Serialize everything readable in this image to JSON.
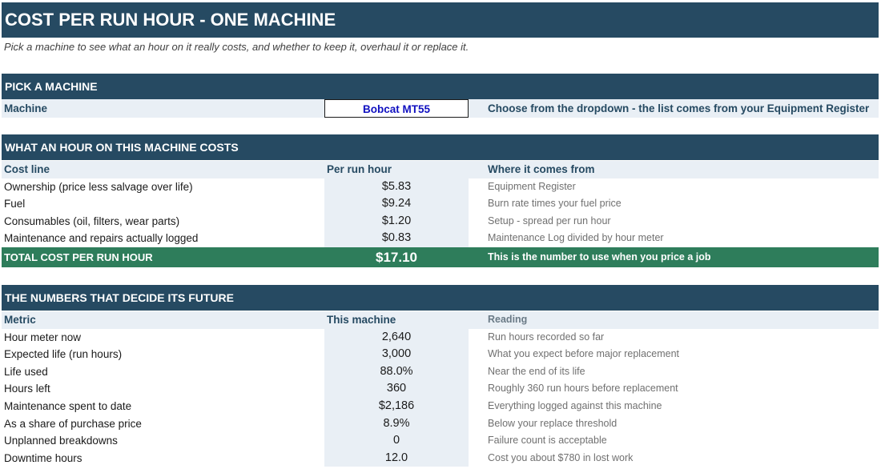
{
  "title": "COST PER RUN HOUR - ONE MACHINE",
  "subtitle": "Pick a machine to see what an hour on it really costs, and whether to keep it, overhaul it or replace it.",
  "pick": {
    "header": "PICK A MACHINE",
    "label": "Machine",
    "value": "Bobcat MT55",
    "hint": "Choose from the dropdown - the list comes from your Equipment Register"
  },
  "costs": {
    "header": "WHAT AN HOUR ON THIS MACHINE COSTS",
    "col1": "Cost line",
    "col2": "Per run hour",
    "col3": "Where it comes from",
    "rows": [
      {
        "label": "Ownership (price less salvage over life)",
        "value": "$5.83",
        "source": "Equipment Register"
      },
      {
        "label": "Fuel",
        "value": "$9.24",
        "source": "Burn rate times your fuel price"
      },
      {
        "label": "Consumables (oil, filters, wear parts)",
        "value": "$1.20",
        "source": "Setup - spread per run hour"
      },
      {
        "label": "Maintenance and repairs actually logged",
        "value": "$0.83",
        "source": "Maintenance Log divided by hour meter"
      }
    ],
    "total": {
      "label": "TOTAL COST PER RUN HOUR",
      "value": "$17.10",
      "note": "This is the number to use when you price a job"
    }
  },
  "future": {
    "header": "THE NUMBERS THAT DECIDE ITS FUTURE",
    "col1": "Metric",
    "col2": "This machine",
    "col3": "Reading",
    "rows": [
      {
        "label": "Hour meter now",
        "value": "2,640",
        "reading": "Run hours recorded so far"
      },
      {
        "label": "Expected life (run hours)",
        "value": "3,000",
        "reading": "What you expect before major replacement"
      },
      {
        "label": "Life used",
        "value": "88.0%",
        "reading": "Near the end of its life"
      },
      {
        "label": "Hours left",
        "value": "360",
        "reading": "Roughly 360 run hours before replacement"
      },
      {
        "label": "Maintenance spent to date",
        "value": "$2,186",
        "reading": "Everything logged against this machine"
      },
      {
        "label": "As a share of purchase price",
        "value": "8.9%",
        "reading": "Below your replace threshold"
      },
      {
        "label": "Unplanned breakdowns",
        "value": "0",
        "reading": "Failure count is acceptable"
      },
      {
        "label": "Downtime hours",
        "value": "12.0",
        "reading": "Cost you about $780 in lost work"
      }
    ]
  }
}
